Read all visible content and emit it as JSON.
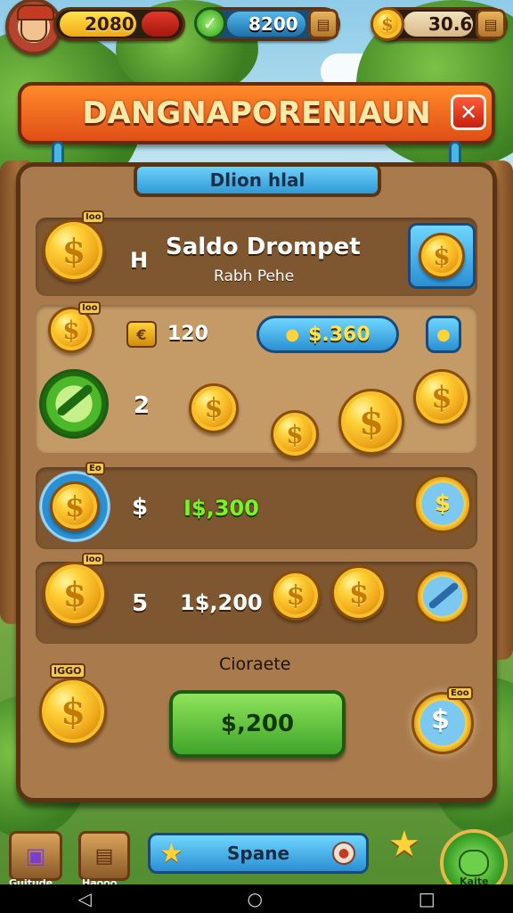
{
  "topbar": {
    "coins": "2080",
    "gems": "8200",
    "gold": "30.6"
  },
  "title": "DANGNAPORENIAUN",
  "subtitle": "Dlion hlal",
  "rows": {
    "header": {
      "mark": "H",
      "title": "Saldo Drompet",
      "subtitle": "Rabh Pehe",
      "coin_tag": "Ioo"
    },
    "row1": {
      "amount": "120",
      "button_value": "$.360",
      "coin_tag": "Ioo"
    },
    "row2": {
      "amount": "2"
    },
    "row3": {
      "symbol": "$",
      "value": "I$,300",
      "coin_tag": "Eo"
    },
    "row4": {
      "amount": "5",
      "value": "1$,200",
      "coin_tag": "Ioo"
    }
  },
  "footer": {
    "caption": "Cioraete",
    "button": "$,200",
    "left_tag": "IGGO",
    "right_tag": "Eoo"
  },
  "bottombar": {
    "item1_label": "Guitude",
    "item2_label": "Haooo",
    "center_label": "Spane",
    "right_label": "Kaite"
  },
  "colors": {
    "accent_orange": "#e04e16",
    "panel": "#a97a4b",
    "green": "#3fa52a",
    "blue": "#2b8fd2"
  }
}
